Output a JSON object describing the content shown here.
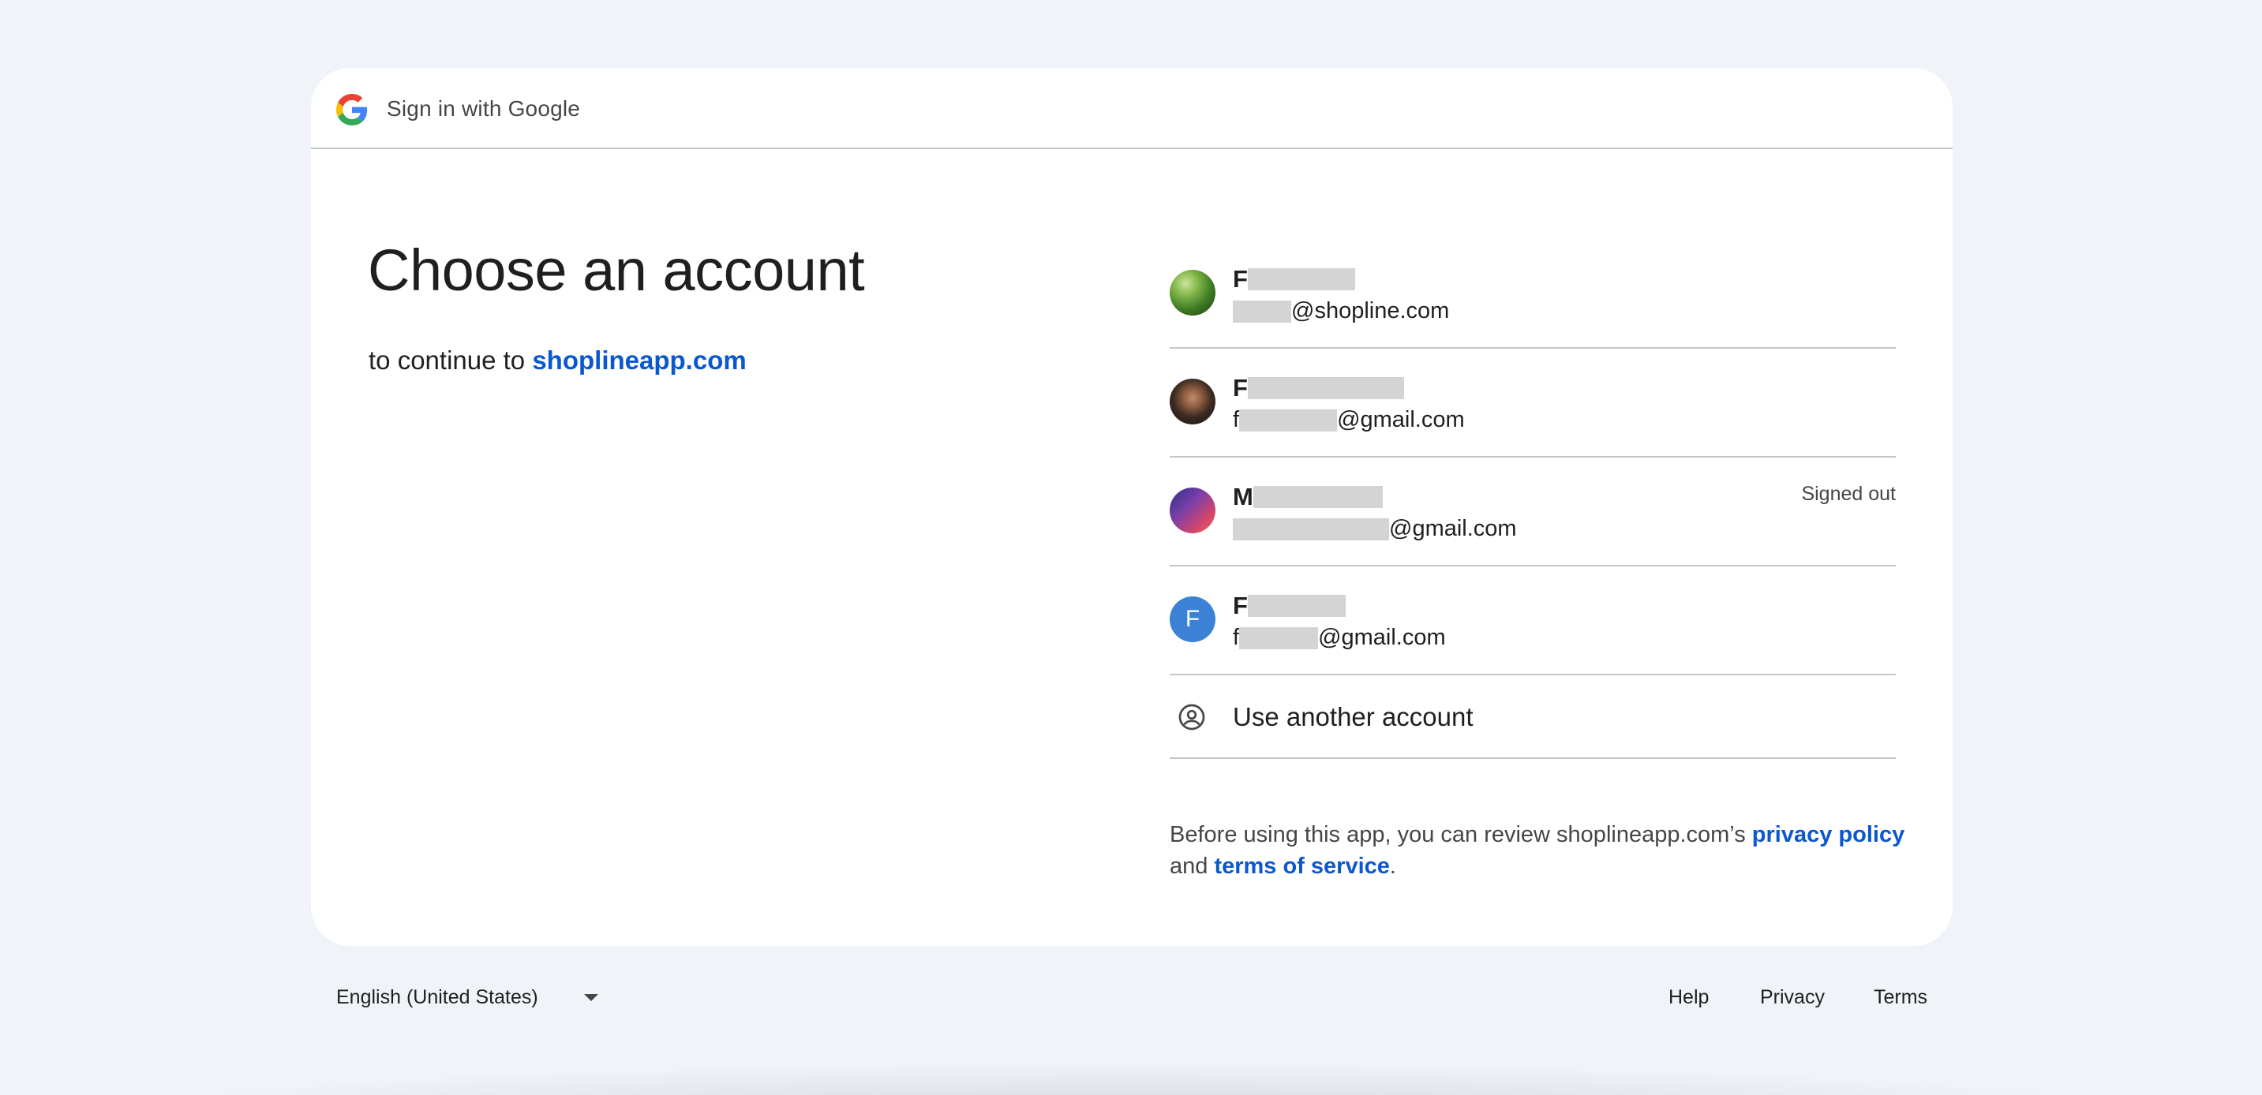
{
  "header": {
    "logo_icon": "google-g-icon",
    "title": "Sign in with Google"
  },
  "main": {
    "heading": "Choose an account",
    "subtitle_prefix": "to continue to",
    "subtitle_link": "shoplineapp.com"
  },
  "accounts": [
    {
      "name_visible": "F",
      "email_visible": "@shopline.com",
      "email_prefix": "",
      "avatar": "leaf-photo-avatar",
      "status": ""
    },
    {
      "name_visible": "F",
      "email_visible": "@gmail.com",
      "email_prefix": "f",
      "avatar": "person-photo-avatar",
      "status": ""
    },
    {
      "name_visible": "M",
      "email_visible": "@gmail.com",
      "email_prefix": "",
      "avatar": "gradient-avatar",
      "status": "Signed out"
    },
    {
      "name_visible": "F",
      "email_visible": "@gmail.com",
      "email_prefix": "f",
      "avatar": "letter-avatar",
      "avatar_letter": "F",
      "status": ""
    }
  ],
  "use_another": {
    "icon": "account-circle-icon",
    "label": "Use another account"
  },
  "disclaimer": {
    "part1": "Before using this app, you can review shoplineapp.com’s",
    "privacy_link": "privacy policy",
    "part2": "and",
    "terms_link": "terms of service",
    "part3": "."
  },
  "footer": {
    "language": "English (United States)",
    "links": [
      "Help",
      "Privacy",
      "Terms"
    ]
  },
  "colors": {
    "background": "#f0f4f9",
    "link": "#0b57d0",
    "divider": "#c4c7c5",
    "letter_avatar": "#3b82d6"
  }
}
